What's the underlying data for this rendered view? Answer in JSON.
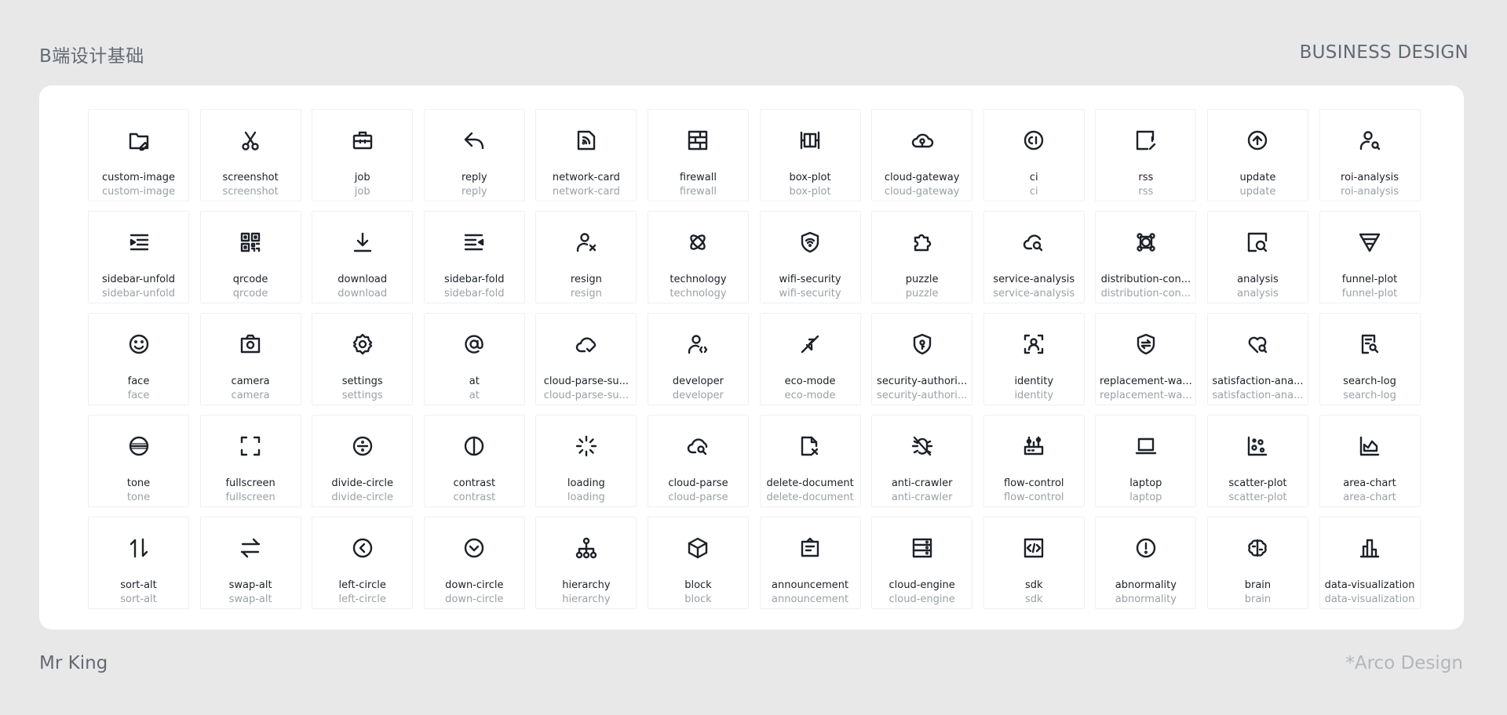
{
  "header": {
    "title_left": "B端设计基础",
    "title_right": "BUSINESS DESIGN"
  },
  "footer": {
    "author": "Mr King",
    "source": "*Arco Design"
  },
  "icons": [
    {
      "name": "custom-image",
      "sub": "custom-image"
    },
    {
      "name": "screenshot",
      "sub": "screenshot"
    },
    {
      "name": "job",
      "sub": "job"
    },
    {
      "name": "reply",
      "sub": "reply"
    },
    {
      "name": "network-card",
      "sub": "network-card"
    },
    {
      "name": "firewall",
      "sub": "firewall"
    },
    {
      "name": "box-plot",
      "sub": "box-plot"
    },
    {
      "name": "cloud-gateway",
      "sub": "cloud-gateway"
    },
    {
      "name": "ci",
      "sub": "ci"
    },
    {
      "name": "rss",
      "sub": "rss"
    },
    {
      "name": "update",
      "sub": "update"
    },
    {
      "name": "roi-analysis",
      "sub": "roi-analysis"
    },
    {
      "name": "sidebar-unfold",
      "sub": "sidebar-unfold"
    },
    {
      "name": "qrcode",
      "sub": "qrcode"
    },
    {
      "name": "download",
      "sub": "download"
    },
    {
      "name": "sidebar-fold",
      "sub": "sidebar-fold"
    },
    {
      "name": "resign",
      "sub": "resign"
    },
    {
      "name": "technology",
      "sub": "technology"
    },
    {
      "name": "wifi-security",
      "sub": "wifi-security"
    },
    {
      "name": "puzzle",
      "sub": "puzzle"
    },
    {
      "name": "service-analysis",
      "sub": "service-analysis"
    },
    {
      "name": "distribution-con...",
      "sub": "distribution-con..."
    },
    {
      "name": "analysis",
      "sub": "analysis"
    },
    {
      "name": "funnel-plot",
      "sub": "funnel-plot"
    },
    {
      "name": "face",
      "sub": "face"
    },
    {
      "name": "camera",
      "sub": "camera"
    },
    {
      "name": "settings",
      "sub": "settings"
    },
    {
      "name": "at",
      "sub": "at"
    },
    {
      "name": "cloud-parse-su...",
      "sub": "cloud-parse-su..."
    },
    {
      "name": "developer",
      "sub": "developer"
    },
    {
      "name": "eco-mode",
      "sub": "eco-mode"
    },
    {
      "name": "security-authori...",
      "sub": "security-authori..."
    },
    {
      "name": "identity",
      "sub": "identity"
    },
    {
      "name": "replacement-wa...",
      "sub": "replacement-wa..."
    },
    {
      "name": "satisfaction-ana...",
      "sub": "satisfaction-ana..."
    },
    {
      "name": "search-log",
      "sub": "search-log"
    },
    {
      "name": "tone",
      "sub": "tone"
    },
    {
      "name": "fullscreen",
      "sub": "fullscreen"
    },
    {
      "name": "divide-circle",
      "sub": "divide-circle"
    },
    {
      "name": "contrast",
      "sub": "contrast"
    },
    {
      "name": "loading",
      "sub": "loading"
    },
    {
      "name": "cloud-parse",
      "sub": "cloud-parse"
    },
    {
      "name": "delete-document",
      "sub": "delete-document"
    },
    {
      "name": "anti-crawler",
      "sub": "anti-crawler"
    },
    {
      "name": "flow-control",
      "sub": "flow-control"
    },
    {
      "name": "laptop",
      "sub": "laptop"
    },
    {
      "name": "scatter-plot",
      "sub": "scatter-plot"
    },
    {
      "name": "area-chart",
      "sub": "area-chart"
    },
    {
      "name": "sort-alt",
      "sub": "sort-alt"
    },
    {
      "name": "swap-alt",
      "sub": "swap-alt"
    },
    {
      "name": "left-circle",
      "sub": "left-circle"
    },
    {
      "name": "down-circle",
      "sub": "down-circle"
    },
    {
      "name": "hierarchy",
      "sub": "hierarchy"
    },
    {
      "name": "block",
      "sub": "block"
    },
    {
      "name": "announcement",
      "sub": "announcement"
    },
    {
      "name": "cloud-engine",
      "sub": "cloud-engine"
    },
    {
      "name": "sdk",
      "sub": "sdk"
    },
    {
      "name": "abnormality",
      "sub": "abnormality"
    },
    {
      "name": "brain",
      "sub": "brain"
    },
    {
      "name": "data-visualization",
      "sub": "data-visualization"
    }
  ]
}
